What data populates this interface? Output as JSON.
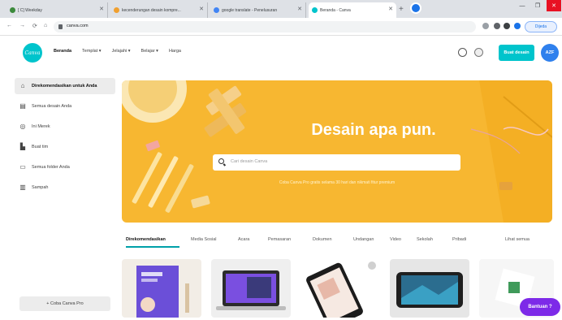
{
  "browser": {
    "tabs": [
      {
        "label": "[ C] Weekday",
        "favicon_color": "#3c8a3c",
        "active": false
      },
      {
        "label": "kecenderungan desain kompre...",
        "favicon_color": "#f0a030",
        "active": false
      },
      {
        "label": "google translate - Penelusuran",
        "favicon_color": "#4285f4",
        "active": false
      },
      {
        "label": "Beranda - Canva",
        "favicon_color": "#00c4cc",
        "active": true
      }
    ],
    "url": "canva.com",
    "profile_label": "Dijeda"
  },
  "header": {
    "logo_text": "Canva",
    "nav": [
      "Beranda",
      "Templat",
      "Jelajahi",
      "Belajar",
      "Harga"
    ],
    "cta_label": "Buat desain",
    "avatar_initials": "AZF"
  },
  "sidebar": {
    "items": [
      {
        "label": "Direkomendasikan untuk Anda",
        "icon": "home-icon"
      },
      {
        "label": "Semua desain Anda",
        "icon": "document-icon"
      },
      {
        "label": "Ini Merek",
        "icon": "brand-icon"
      },
      {
        "label": "Buat tim",
        "icon": "team-icon"
      },
      {
        "label": "Semua folder Anda",
        "icon": "folder-icon"
      },
      {
        "label": "Sampah",
        "icon": "trash-icon"
      }
    ],
    "team_button": "+ Coba Canva Pro"
  },
  "hero": {
    "title": "Desain apa pun.",
    "search_placeholder": "Cari desain Canva",
    "note": "Coba Canva Pro gratis selama 30 hari dan nikmati fitur premium",
    "colors": {
      "background": "#f7b731"
    }
  },
  "categories": {
    "tabs": [
      "Direkomendasikan",
      "Media Sosial",
      "Acara",
      "Pemasaran",
      "Dokumen",
      "Undangan",
      "Video",
      "Sekolah",
      "Pribadi"
    ],
    "see_all": "Lihat semua"
  },
  "help_button": "Bantuan ?"
}
